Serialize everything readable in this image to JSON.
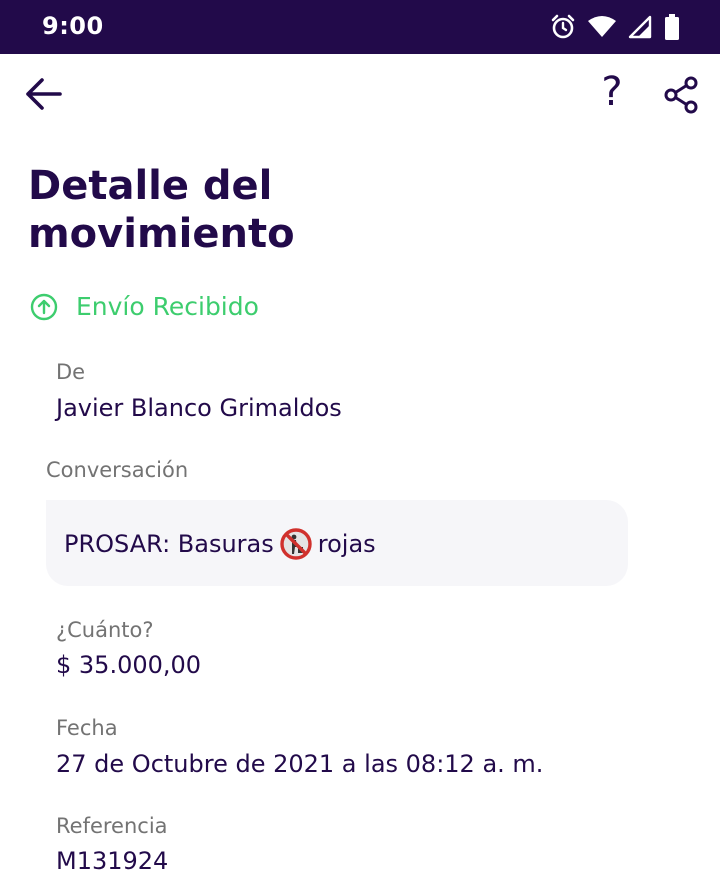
{
  "status_bar": {
    "time": "9:00",
    "icons": [
      "alarm-icon",
      "wifi-icon",
      "signal-icon",
      "battery-icon"
    ]
  },
  "toolbar": {
    "back_icon": "arrow-left-icon",
    "help_label": "?",
    "share_icon": "share-icon"
  },
  "page": {
    "title": "Detalle del movimiento"
  },
  "transaction": {
    "status_icon": "arrow-up-circle-icon",
    "status": "Envío Recibido",
    "status_color": "#3dcd6e",
    "from_label": "De",
    "from_value": "Javier Blanco Grimaldos",
    "conversation_label": "Conversación",
    "conversation_text_before": "PROSAR: Basuras",
    "conversation_emoji": "no-littering-icon",
    "conversation_text_after": "rojas",
    "amount_label": "¿Cuánto?",
    "amount_value": "$ 35.000,00",
    "date_label": "Fecha",
    "date_value": "27 de Octubre de 2021 a las 08:12 a. m.",
    "reference_label": "Referencia",
    "reference_value": "M131924"
  },
  "colors": {
    "brand_dark": "#220a4a",
    "success": "#3dcd6e",
    "label_gray": "#737373",
    "bubble_bg": "#f6f6f9"
  }
}
